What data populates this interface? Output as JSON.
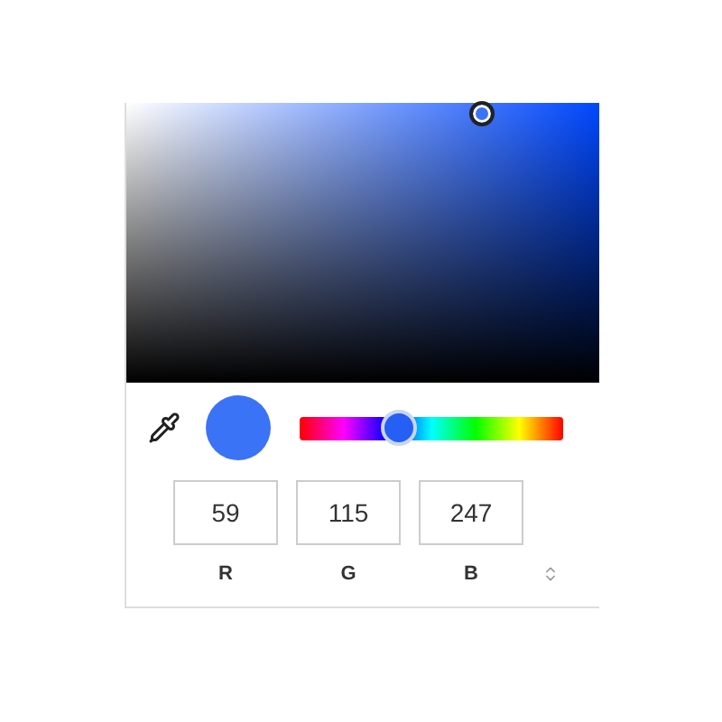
{
  "hue_slider": {
    "level": 0.38
  },
  "channels": [
    {
      "value": "59",
      "label": "R"
    },
    {
      "value": "115",
      "label": "G"
    },
    {
      "value": "247",
      "label": "B"
    }
  ]
}
